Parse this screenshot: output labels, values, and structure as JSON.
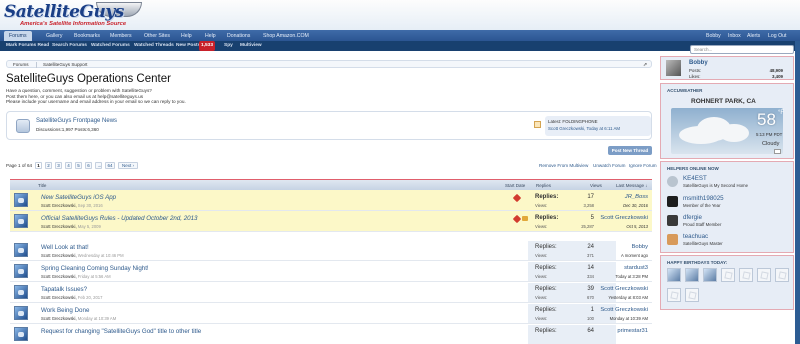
{
  "brand": {
    "name": "SatelliteGuys",
    "tagline": "America's Satellite Information Source"
  },
  "nav": {
    "tabs": [
      "Forums",
      "Gallery",
      "Bookmarks",
      "Members",
      "Other Sites",
      "Help",
      "Help",
      "Donations",
      "Shop Amazon.COM"
    ],
    "user_links": [
      "Bobby",
      "Inbox",
      "Alerts",
      "Log Out"
    ]
  },
  "subnav": {
    "items": [
      "Mark Forums Read",
      "Search Forums",
      "Watched Forums",
      "Watched Threads",
      "New Posts",
      "Spy",
      "Multiview"
    ],
    "new_posts_count": "1,533"
  },
  "search": {
    "placeholder": "Search..."
  },
  "breadcrumb": [
    "Forums",
    "SatelliteGuys Support"
  ],
  "forum": {
    "title": "SatelliteGuys Operations Center",
    "description": [
      "Have a question, comment, suggestion or problem with SatelliteGuys?",
      "Post them here, or you can also email us at help@satelliteguys.us",
      "Please include your username and email address in your email so we can reply to you."
    ]
  },
  "subforum": {
    "name": "SatelliteGuys Frontpage News",
    "stats": "Discussions:1,997 Posts:6,360",
    "latest_label": "Latest: FOLDINGPHONE",
    "latest_by": "Scott Greczkowski, Today at 6:11 AM"
  },
  "actions": {
    "post_new": "Post New Thread"
  },
  "pager": {
    "label": "Page 1 of 64",
    "pages": [
      "1",
      "2",
      "3",
      "4",
      "5",
      "6",
      "→",
      "64",
      "Next ›"
    ]
  },
  "forum_tools": [
    "Remove From Multiview",
    "Unwatch Forum",
    "Ignore Forum"
  ],
  "table": {
    "headers": {
      "title": "Title",
      "start_date": "Start Date",
      "replies": "Replies",
      "views": "Views",
      "last_message": "Last Message ↓"
    },
    "reply_label": "Replies:",
    "views_label": "Views:",
    "threads": [
      {
        "title": "New SatelliteGuys iOS App",
        "author": "Scott Greczkowski,",
        "date": "Sep 30, 2016",
        "replies": "17",
        "views": "3,258",
        "last_user": "JR_Boss",
        "last_date": "Dec 30, 2016",
        "sticky": true,
        "lock": false
      },
      {
        "title": "Official SatelliteGuys Rules - Updated October 2nd, 2013",
        "author": "Scott Greczkowski,",
        "date": "May 5, 2009",
        "replies": "5",
        "views": "25,287",
        "last_user": "Scott Greczkowski",
        "last_date": "Oct 5, 2013",
        "sticky": true,
        "lock": true
      },
      {
        "title": "Well Look at that!",
        "author": "Scott Greczkowski,",
        "date": "Wednesday at 10:46 PM",
        "replies": "24",
        "views": "371",
        "last_user": "Bobby",
        "last_date": "A moment ago",
        "sticky": false,
        "lock": false
      },
      {
        "title": "Spring Cleaning Coming Sunday Night!",
        "author": "Scott Greczkowski,",
        "date": "Friday at 5:56 AM",
        "replies": "14",
        "views": "334",
        "last_user": "stardust3",
        "last_date": "Today at 3:28 PM",
        "sticky": false,
        "lock": false
      },
      {
        "title": "Tapatalk Issues?",
        "author": "Scott Greczkowski,",
        "date": "Feb 20, 2017",
        "replies": "39",
        "views": "670",
        "last_user": "Scott Greczkowski",
        "last_date": "Yesterday at 8:03 AM",
        "sticky": false,
        "lock": false
      },
      {
        "title": "Work Being Done",
        "author": "Scott Greczkowski,",
        "date": "Monday at 10:39 AM",
        "replies": "1",
        "views": "100",
        "last_user": "Scott Greczkowski",
        "last_date": "Monday at 10:39 AM",
        "sticky": false,
        "lock": false
      },
      {
        "title": "Request for changing \"SatelliteGuys God\" title to other title",
        "author": "",
        "date": "",
        "replies": "64",
        "views": "",
        "last_user": "primestar31",
        "last_date": "",
        "sticky": false,
        "lock": false
      }
    ]
  },
  "visitor": {
    "name": "Bobby",
    "posts_label": "Posts:",
    "posts": "48,909",
    "likes_label": "Likes:",
    "likes": "3,409"
  },
  "weather": {
    "header": "ACCUWEATHER",
    "location": "ROHNERT PARK, CA",
    "temp": "58",
    "unit": "°F",
    "time": "5:13 PM PDT",
    "condition": "Cloudy"
  },
  "online": {
    "header": "HELPERS ONLINE NOW",
    "users": [
      {
        "name": "KE4EST",
        "title": "SatelliteGuys is My Second Home",
        "color": "#b9c4cf"
      },
      {
        "name": "msmith198025",
        "title": "Member of the Year",
        "color": "#1d1d1d"
      },
      {
        "name": "dfergie",
        "title": "Proud Staff Member",
        "color": "#3a3a3a"
      },
      {
        "name": "teachuac",
        "title": "SatelliteGuys Master",
        "color": "#d89a5a"
      }
    ]
  },
  "birthdays": {
    "header": "HAPPY BIRTHDAYS TODAY:"
  }
}
